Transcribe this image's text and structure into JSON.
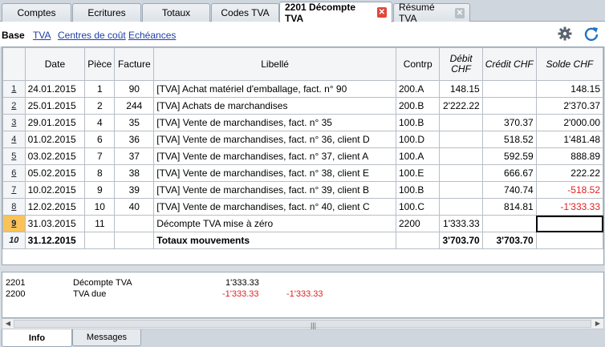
{
  "tabs": [
    {
      "label": "Comptes"
    },
    {
      "label": "Ecritures"
    },
    {
      "label": "Totaux"
    },
    {
      "label": "Codes TVA"
    },
    {
      "label": "2201 Décompte TVA"
    },
    {
      "label": "Résumé TVA"
    }
  ],
  "views": {
    "base": "Base",
    "tva": "TVA",
    "cost_centers": "Centres de coût",
    "due": "Echéances"
  },
  "icons": {
    "settings": "gear-icon",
    "refresh": "refresh-icon",
    "close": "close-icon"
  },
  "colors": {
    "accent": "#f9c25a",
    "negative": "#e02020",
    "link": "#1b3fa8",
    "close": "#e0483a"
  },
  "table": {
    "headers": {
      "date": "Date",
      "piece": "Pièce",
      "facture": "Facture",
      "libelle": "Libellé",
      "contrp": "Contrp",
      "debit_line1": "Débit",
      "debit_line2": "CHF",
      "credit": "Crédit CHF",
      "solde": "Solde CHF"
    },
    "rows": [
      {
        "n": "1",
        "date": "24.01.2015",
        "piece": "1",
        "facture": "90",
        "libelle": "[TVA] Achat matériel d'emballage, fact. n° 90",
        "contrp": "200.A",
        "debit": "148.15",
        "credit": "",
        "solde": "148.15"
      },
      {
        "n": "2",
        "date": "25.01.2015",
        "piece": "2",
        "facture": "244",
        "libelle": "[TVA] Achats de marchandises",
        "contrp": "200.B",
        "debit": "2'222.22",
        "credit": "",
        "solde": "2'370.37"
      },
      {
        "n": "3",
        "date": "29.01.2015",
        "piece": "4",
        "facture": "35",
        "libelle": "[TVA] Vente de marchandises, fact. n° 35",
        "contrp": "100.B",
        "debit": "",
        "credit": "370.37",
        "solde": "2'000.00"
      },
      {
        "n": "4",
        "date": "01.02.2015",
        "piece": "6",
        "facture": "36",
        "libelle": "[TVA] Vente de marchandises, fact. n° 36, client D",
        "contrp": "100.D",
        "debit": "",
        "credit": "518.52",
        "solde": "1'481.48"
      },
      {
        "n": "5",
        "date": "03.02.2015",
        "piece": "7",
        "facture": "37",
        "libelle": "[TVA] Vente de marchandises, fact. n° 37, client A",
        "contrp": "100.A",
        "debit": "",
        "credit": "592.59",
        "solde": "888.89"
      },
      {
        "n": "6",
        "date": "05.02.2015",
        "piece": "8",
        "facture": "38",
        "libelle": "[TVA] Vente de marchandises, fact. n° 38, client E",
        "contrp": "100.E",
        "debit": "",
        "credit": "666.67",
        "solde": "222.22"
      },
      {
        "n": "7",
        "date": "10.02.2015",
        "piece": "9",
        "facture": "39",
        "libelle": "[TVA] Vente de marchandises, fact. n° 39, client B",
        "contrp": "100.B",
        "debit": "",
        "credit": "740.74",
        "solde": "-518.52"
      },
      {
        "n": "8",
        "date": "12.02.2015",
        "piece": "10",
        "facture": "40",
        "libelle": "[TVA] Vente de marchandises, fact. n° 40, client C",
        "contrp": "100.C",
        "debit": "",
        "credit": "814.81",
        "solde": "-1'333.33"
      },
      {
        "n": "9",
        "date": "31.03.2015",
        "piece": "11",
        "facture": "",
        "libelle": "Décompte TVA mise à zéro",
        "contrp": "2200",
        "debit": "1'333.33",
        "credit": "",
        "solde": ""
      },
      {
        "n": "10",
        "date": "31.12.2015",
        "piece": "",
        "facture": "",
        "libelle": "Totaux  mouvements",
        "contrp": "",
        "debit": "3'703.70",
        "credit": "3'703.70",
        "solde": ""
      }
    ]
  },
  "info": {
    "rows": [
      {
        "account": "2201",
        "desc": "Décompte TVA",
        "amount1": "1'333.33",
        "amount2": ""
      },
      {
        "account": "2200",
        "desc": "TVA due",
        "amount1": "-1'333.33",
        "amount2": "-1'333.33"
      }
    ]
  },
  "bottom_tabs": [
    {
      "label": "Info"
    },
    {
      "label": "Messages"
    }
  ]
}
